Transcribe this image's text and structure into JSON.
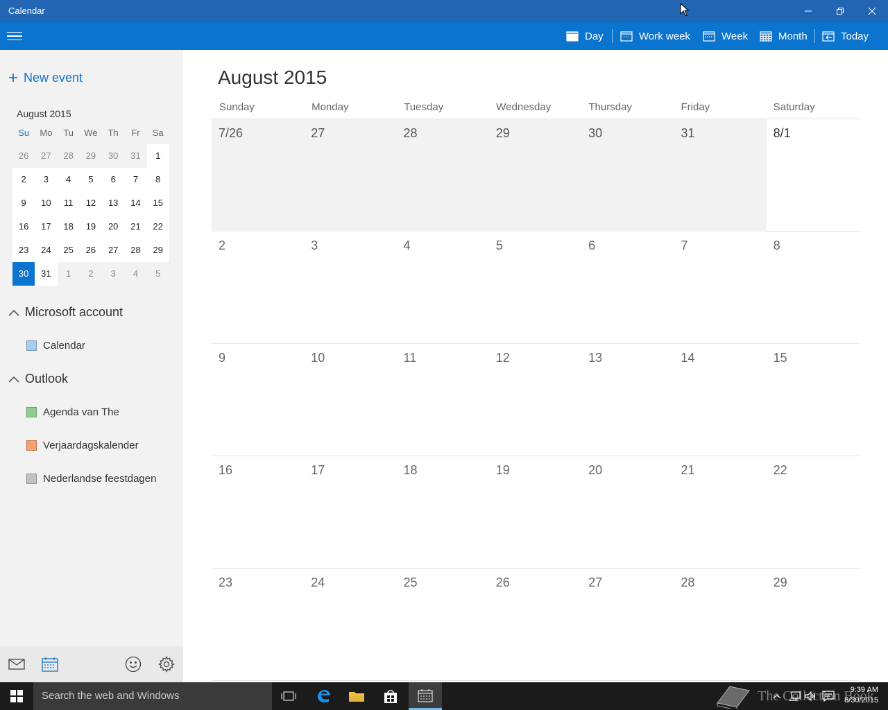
{
  "window": {
    "title": "Calendar"
  },
  "toolbar": {
    "menu_icon": "hamburger-icon",
    "day_label": "Day",
    "workweek_label": "Work week",
    "week_label": "Week",
    "month_label": "Month",
    "today_label": "Today"
  },
  "sidebar": {
    "new_event_label": "New event",
    "mini_calendar": {
      "title": "August 2015",
      "weekdays": [
        "Su",
        "Mo",
        "Tu",
        "We",
        "Th",
        "Fr",
        "Sa"
      ],
      "weeks": [
        [
          {
            "d": "26",
            "other": true
          },
          {
            "d": "27",
            "other": true
          },
          {
            "d": "28",
            "other": true
          },
          {
            "d": "29",
            "other": true
          },
          {
            "d": "30",
            "other": true
          },
          {
            "d": "31",
            "other": true
          },
          {
            "d": "1"
          }
        ],
        [
          {
            "d": "2"
          },
          {
            "d": "3"
          },
          {
            "d": "4"
          },
          {
            "d": "5"
          },
          {
            "d": "6"
          },
          {
            "d": "7"
          },
          {
            "d": "8"
          }
        ],
        [
          {
            "d": "9"
          },
          {
            "d": "10"
          },
          {
            "d": "11"
          },
          {
            "d": "12"
          },
          {
            "d": "13"
          },
          {
            "d": "14"
          },
          {
            "d": "15"
          }
        ],
        [
          {
            "d": "16"
          },
          {
            "d": "17"
          },
          {
            "d": "18"
          },
          {
            "d": "19"
          },
          {
            "d": "20"
          },
          {
            "d": "21"
          },
          {
            "d": "22"
          }
        ],
        [
          {
            "d": "23"
          },
          {
            "d": "24"
          },
          {
            "d": "25"
          },
          {
            "d": "26"
          },
          {
            "d": "27"
          },
          {
            "d": "28"
          },
          {
            "d": "29"
          }
        ],
        [
          {
            "d": "30",
            "today": true
          },
          {
            "d": "31"
          },
          {
            "d": "1",
            "other": true
          },
          {
            "d": "2",
            "other": true
          },
          {
            "d": "3",
            "other": true
          },
          {
            "d": "4",
            "other": true
          },
          {
            "d": "5",
            "other": true
          }
        ]
      ]
    },
    "groups": [
      {
        "label": "Microsoft account",
        "calendars": [
          {
            "label": "Calendar",
            "color": "#a6cdf2"
          }
        ]
      },
      {
        "label": "Outlook",
        "calendars": [
          {
            "label": "Agenda van The",
            "color": "#8fd08f"
          },
          {
            "label": "Verjaardagskalender",
            "color": "#f5a16b"
          },
          {
            "label": "Nederlandse feestdagen",
            "color": "#c2c2c2"
          }
        ]
      }
    ]
  },
  "main": {
    "month_title": "August 2015",
    "weekdays": [
      "Sunday",
      "Monday",
      "Tuesday",
      "Wednesday",
      "Thursday",
      "Friday",
      "Saturday"
    ],
    "weeks": [
      [
        {
          "d": "7/26",
          "prev": true
        },
        {
          "d": "27",
          "prev": true
        },
        {
          "d": "28",
          "prev": true
        },
        {
          "d": "29",
          "prev": true
        },
        {
          "d": "30",
          "prev": true
        },
        {
          "d": "31",
          "prev": true
        },
        {
          "d": "8/1",
          "first": true
        }
      ],
      [
        {
          "d": "2"
        },
        {
          "d": "3"
        },
        {
          "d": "4"
        },
        {
          "d": "5"
        },
        {
          "d": "6"
        },
        {
          "d": "7"
        },
        {
          "d": "8"
        }
      ],
      [
        {
          "d": "9"
        },
        {
          "d": "10"
        },
        {
          "d": "11"
        },
        {
          "d": "12"
        },
        {
          "d": "13"
        },
        {
          "d": "14"
        },
        {
          "d": "15"
        }
      ],
      [
        {
          "d": "16"
        },
        {
          "d": "17"
        },
        {
          "d": "18"
        },
        {
          "d": "19"
        },
        {
          "d": "20"
        },
        {
          "d": "21"
        },
        {
          "d": "22"
        }
      ],
      [
        {
          "d": "23"
        },
        {
          "d": "24"
        },
        {
          "d": "25"
        },
        {
          "d": "26"
        },
        {
          "d": "27"
        },
        {
          "d": "28"
        },
        {
          "d": "29"
        }
      ]
    ]
  },
  "taskbar": {
    "search_placeholder": "Search the web and Windows",
    "time": "9:39 AM",
    "date": "8/30/2015",
    "watermark": "The Collection Book"
  },
  "colors": {
    "titlebar": "#2266b3",
    "toolbar": "#0a74cf",
    "accent": "#1672c9",
    "sidebar": "#f2f2f2",
    "prev_month_cell": "#f2f2f2",
    "taskbar": "#1b1b1b"
  }
}
